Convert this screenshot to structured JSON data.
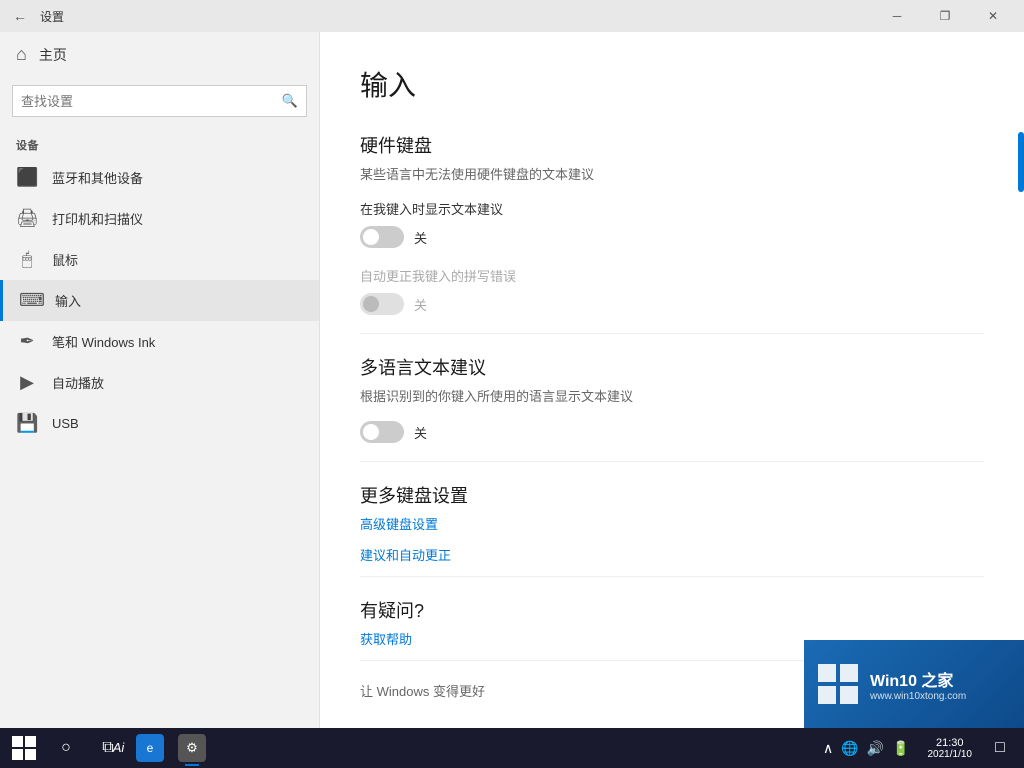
{
  "window": {
    "title": "设置",
    "back_label": "←",
    "min_label": "─",
    "max_label": "❐",
    "close_label": "✕"
  },
  "sidebar": {
    "home_label": "主页",
    "search_placeholder": "查找设置",
    "section_label": "设备",
    "nav_items": [
      {
        "id": "bluetooth",
        "label": "蓝牙和其他设备",
        "icon": "📷"
      },
      {
        "id": "printer",
        "label": "打印机和扫描仪",
        "icon": "🖨"
      },
      {
        "id": "mouse",
        "label": "鼠标",
        "icon": "🖱"
      },
      {
        "id": "input",
        "label": "输入",
        "icon": "⌨",
        "active": true
      },
      {
        "id": "pen",
        "label": "笔和 Windows Ink",
        "icon": "✒"
      },
      {
        "id": "autoplay",
        "label": "自动播放",
        "icon": "▶"
      },
      {
        "id": "usb",
        "label": "USB",
        "icon": "💾"
      }
    ]
  },
  "content": {
    "title": "输入",
    "hardware_keyboard": {
      "section_title": "硬件键盘",
      "section_desc": "某些语言中无法使用硬件键盘的文本建议",
      "toggle1_label": "在我键入时显示文本建议",
      "toggle1_state": "off",
      "toggle1_text": "关",
      "toggle2_label": "自动更正我键入的拼写错误",
      "toggle2_state": "disabled",
      "toggle2_text": "关"
    },
    "multilang": {
      "section_title": "多语言文本建议",
      "section_desc": "根据识别到的你键入所使用的语言显示文本建议",
      "toggle_state": "off",
      "toggle_text": "关"
    },
    "more_keyboard": {
      "section_title": "更多键盘设置",
      "link1": "高级键盘设置",
      "link2": "建议和自动更正"
    },
    "help": {
      "section_title": "有疑问?",
      "link": "获取帮助"
    },
    "bottom_text": "让 Windows 变得更好"
  },
  "taskbar": {
    "time": "21:30",
    "date": "2021/1/10",
    "chevron": "∧"
  },
  "watermark": {
    "title": "Win10 之家",
    "sub": "www.win10xtong.com"
  }
}
